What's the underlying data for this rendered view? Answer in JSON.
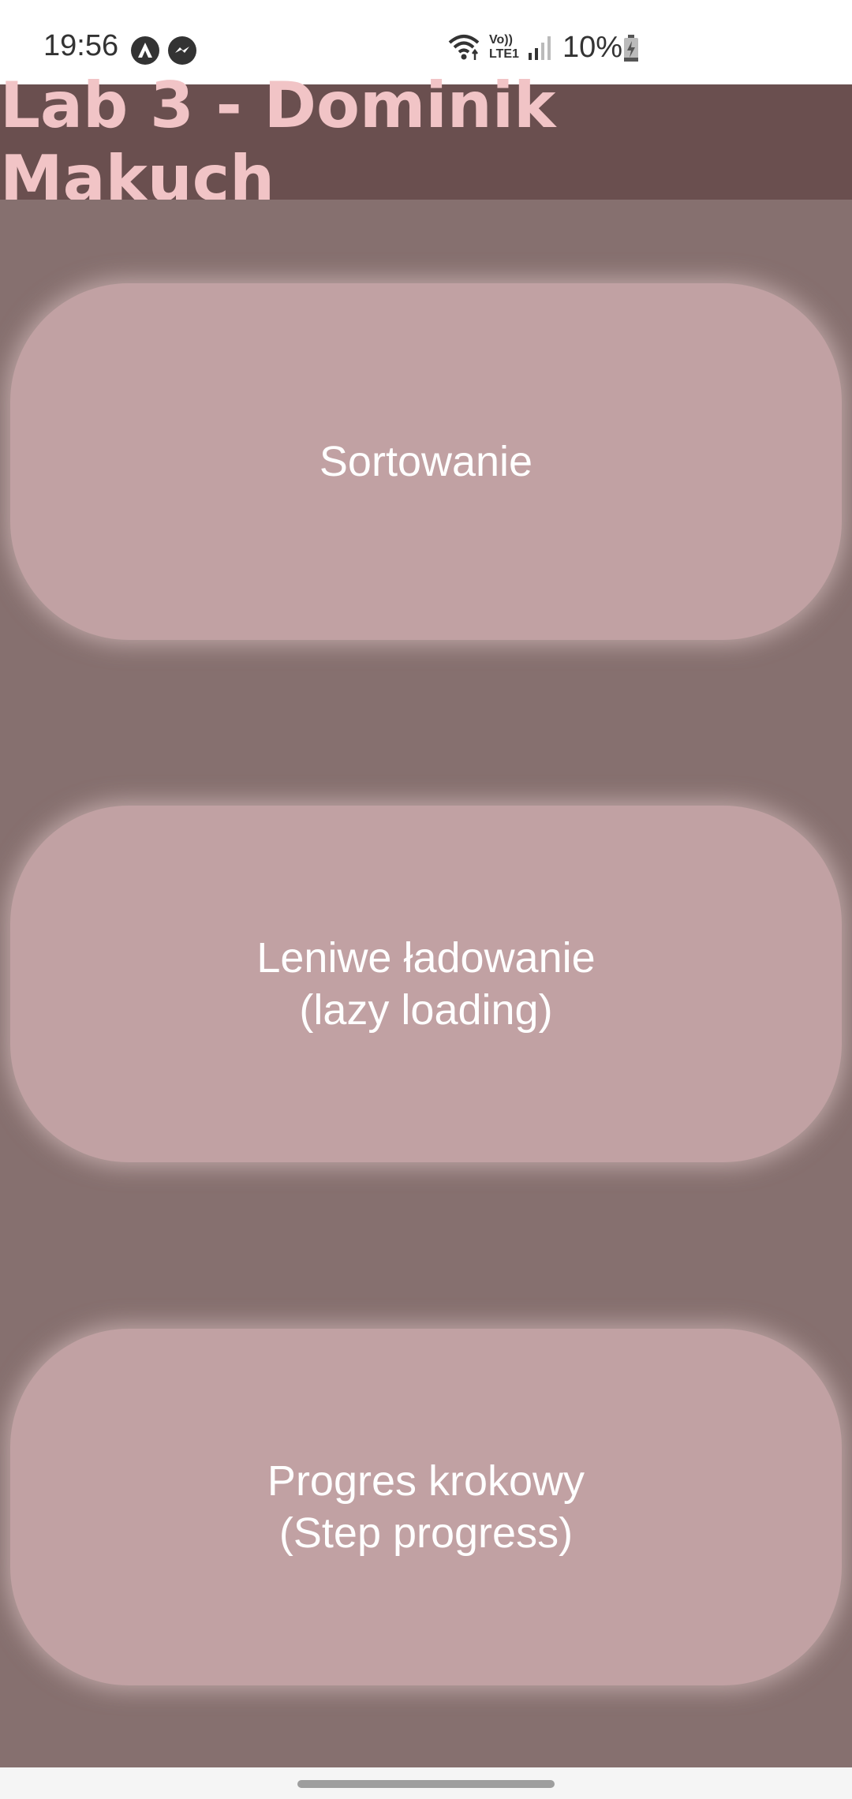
{
  "status_bar": {
    "time": "19:56",
    "battery": "10%",
    "network_label_top": "Vo))",
    "network_label_bottom": "LTE1",
    "icons": [
      "arch-linux-app-icon",
      "messenger-app-icon",
      "wifi-icon",
      "volte-icon",
      "signal-icon",
      "battery-charging-icon"
    ]
  },
  "app_bar": {
    "title": "Lab 3 - Dominik Makuch"
  },
  "menu": {
    "buttons": [
      {
        "label": "Sortowanie"
      },
      {
        "label": "Leniwe ładowanie\n(lazy loading)"
      },
      {
        "label": "Progres krokowy\n(Step progress)"
      }
    ]
  },
  "colors": {
    "app_bar": "#6a4f4f",
    "title": "#f1c4c6",
    "background": "#86706f",
    "button": "#c1a1a3",
    "button_text": "#ffffff"
  }
}
